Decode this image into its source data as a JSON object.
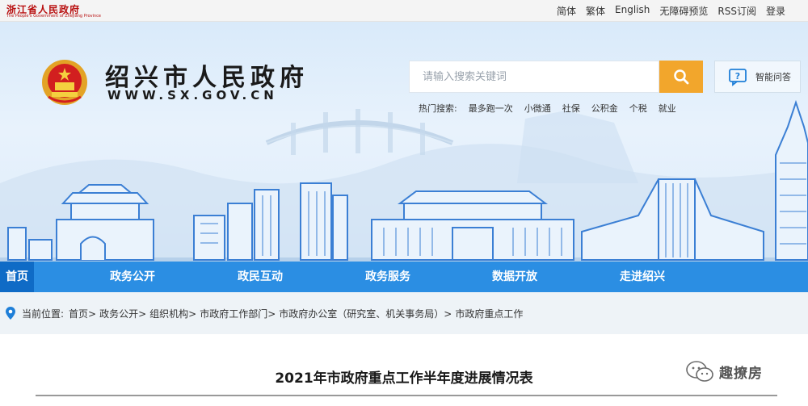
{
  "topbar": {
    "province_name": "浙江省人民政府",
    "province_subtitle": "The People's Government of Zhejiang Province",
    "links": [
      "简体",
      "繁体",
      "English",
      "无障碍预览",
      "RSS订阅",
      "登录"
    ]
  },
  "header": {
    "site_title": "绍兴市人民政府",
    "site_domain": "WWW.SX.GOV.CN",
    "search_placeholder": "请输入搜索关键词",
    "qa_label": "智能问答",
    "hot_search_label": "热门搜索:",
    "hot_search_items": [
      "最多跑一次",
      "小微通",
      "社保",
      "公积金",
      "个税",
      "就业"
    ]
  },
  "nav": {
    "items": [
      "首页",
      "政务公开",
      "政民互动",
      "政务服务",
      "数据开放",
      "走进绍兴"
    ],
    "active_index": 0
  },
  "breadcrumb": {
    "label": "当前位置:",
    "items": [
      "首页>",
      "政务公开>",
      "组织机构>",
      "市政府工作部门>",
      "市政府办公室（研究室、机关事务局）>",
      "市政府重点工作"
    ]
  },
  "article": {
    "title": "2021年市政府重点工作半年度进展情况表"
  },
  "watermark": {
    "text": "趣撩房"
  },
  "colors": {
    "nav_bg": "#2b8ee3",
    "nav_active": "#0f6bc6",
    "search_button": "#f2a62c",
    "province_red": "#b80f0f",
    "breadcrumb_bg": "#eef3f7"
  },
  "icons": [
    "search-icon",
    "chat-question-icon",
    "location-pin-icon",
    "national-emblem-icon",
    "wechat-icon"
  ]
}
